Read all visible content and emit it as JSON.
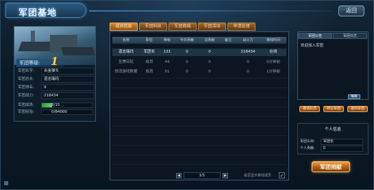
{
  "window": {
    "title": "军团基地",
    "close_label": "返回"
  },
  "left": {
    "level_label": "军团等级:",
    "level_value": "1",
    "info": [
      {
        "label": "军团名字:",
        "value": "合金弹头"
      },
      {
        "label": "军团总长:",
        "value": "道志瑞玛"
      },
      {
        "label": "军团排名:",
        "value": "9"
      },
      {
        "label": "军团战力:",
        "value": "218434"
      }
    ],
    "members": {
      "label": "军团成员:",
      "text": "3/15",
      "fraction": 0.2
    },
    "exp": {
      "label": "军团经验:",
      "text": "0/84000",
      "fraction": 0.0
    }
  },
  "tabs": [
    "成员信息",
    "军团科技",
    "军团商城",
    "军团活动",
    "申请处理"
  ],
  "table": {
    "headers": [
      "名称",
      "职位",
      "等级",
      "今日贡献",
      "总贡献",
      "备注",
      "战斗力",
      "离线时间"
    ],
    "rows": [
      [
        "道志瑞玛",
        "军团长",
        "131",
        "0",
        "0",
        "",
        "218434",
        "在线"
      ],
      [
        "圣腾突轮",
        "成员",
        "44",
        "0",
        "0",
        "",
        "0",
        "0分钟前"
      ],
      [
        "修改游戏数据",
        "成员",
        "51",
        "0",
        "0",
        "",
        "0",
        "1分钟前"
      ]
    ],
    "pager": "1/1",
    "prev_icon": "◀",
    "next_icon": "▶",
    "online_only_label": "是否显示离线成员",
    "online_only_checked": "✓"
  },
  "right": {
    "tabs": [
      "军团公告",
      "军团日志"
    ],
    "notice": "欢迎加入军团",
    "edit_label": "编辑",
    "actions": [
      "邀请队员",
      "转让军团",
      "退出军团"
    ],
    "contrib_title": "个人信息",
    "contrib": [
      {
        "label": "军团头衔:",
        "value": "军团长"
      },
      {
        "label": "个人贡献:",
        "value": "0"
      }
    ],
    "donate_label": "军团捐献"
  }
}
